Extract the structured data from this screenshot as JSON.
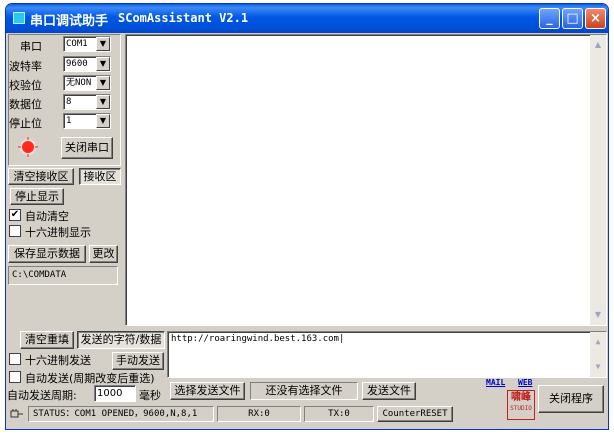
{
  "window": {
    "title_cn": "串口调试助手",
    "title_en": "SComAssistant V2.1",
    "min_glyph": "_",
    "max_glyph": "□",
    "close_glyph": "×"
  },
  "settings": {
    "port": {
      "label": "串口",
      "value": "COM1"
    },
    "baud": {
      "label": "波特率",
      "value": "9600"
    },
    "parity": {
      "label": "校验位",
      "value": "无NON"
    },
    "databits": {
      "label": "数据位",
      "value": "8"
    },
    "stopbits": {
      "label": "停止位",
      "value": "1"
    },
    "close_port_button": "关闭串口",
    "status_led_color": "#ff2a1a"
  },
  "receive": {
    "clear_button": "清空接收区",
    "area_label": "接收区",
    "stop_display_button": "停止显示",
    "auto_clear_label": "自动清空",
    "auto_clear_checked": true,
    "hex_display_label": "十六进制显示",
    "hex_display_checked": false,
    "save_button": "保存显示数据",
    "change_button": "更改",
    "save_path": "C:\\COMDATA",
    "content": ""
  },
  "send": {
    "clear_button": "清空重填",
    "area_label": "发送的字符/数据",
    "content": "http://roaringwind.best.163.com",
    "hex_send_label": "十六进制发送",
    "hex_send_checked": false,
    "manual_send_button": "手动发送",
    "auto_send_label": "自动发送(周期改变后重选)",
    "auto_send_checked": false,
    "period_label": "自动发送周期:",
    "period_value": "1000",
    "period_unit": "毫秒",
    "choose_file_button": "选择发送文件",
    "no_file_text": "还没有选择文件",
    "send_file_button": "发送文件"
  },
  "links": {
    "mail": "MAIL",
    "web": "WEB"
  },
  "logo": {
    "line1": "啸峰",
    "line2": "STUDIO"
  },
  "close_program_button": "关闭程序",
  "status": {
    "status_text": "STATUS：COM1 OPENED，9600,N,8,1",
    "rx": "RX:0",
    "tx": "TX:0",
    "reset_button": "CounterRESET"
  }
}
